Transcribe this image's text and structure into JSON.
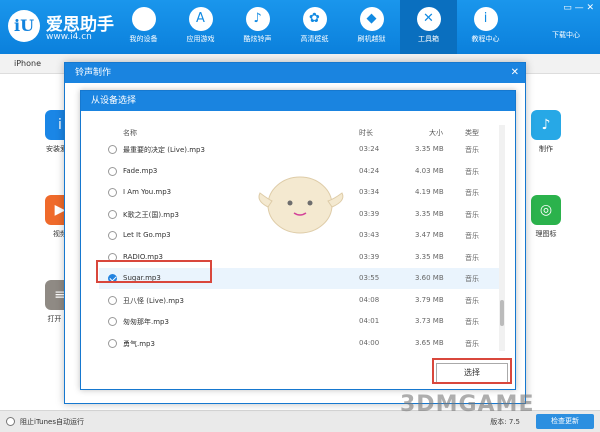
{
  "brand": {
    "name": "爱思助手",
    "url": "www.i4.cn",
    "logo": "iU"
  },
  "nav": [
    {
      "label": "我的设备",
      "icon": "apple-icon",
      "glyph": ""
    },
    {
      "label": "应用游戏",
      "icon": "appstore-icon",
      "glyph": "A"
    },
    {
      "label": "酷炫铃声",
      "icon": "bell-icon",
      "glyph": "♪"
    },
    {
      "label": "高清壁纸",
      "icon": "flower-icon",
      "glyph": "✿"
    },
    {
      "label": "刷机越狱",
      "icon": "box-icon",
      "glyph": "◆"
    },
    {
      "label": "工具箱",
      "icon": "tools-icon",
      "glyph": "✕"
    },
    {
      "label": "教程中心",
      "icon": "info-icon",
      "glyph": "i"
    }
  ],
  "window_controls": "▭  —  ✕",
  "download_label": "下载中心",
  "device_name": "iPhone",
  "bg_tools": [
    {
      "label": "安装爱思",
      "color": "#1a86e6",
      "glyph": "i"
    },
    {
      "label": "视频",
      "color": "#ef6a2b",
      "glyph": "▶"
    },
    {
      "label": "打开 SS",
      "color": "#8f8a84",
      "glyph": "≡"
    },
    {
      "label": "制作",
      "color": "#27a8e6",
      "glyph": "♪"
    },
    {
      "label": "理图标",
      "color": "#2bb24c",
      "glyph": "◎"
    }
  ],
  "bottom": {
    "left_label": "阻止iTunes自动运行",
    "right_label": "版本: 7.5",
    "feedback": "检查更新"
  },
  "outer_dialog": {
    "title": "铃声制作",
    "close": "✕"
  },
  "inner_dialog": {
    "title": "从设备选择"
  },
  "list_header": {
    "name": "名称",
    "time": "时长",
    "size": "大小",
    "type": "类型"
  },
  "files": [
    {
      "name": "最重要的决定 (Live).mp3",
      "time": "03:24",
      "size": "3.35 MB",
      "type": "音乐",
      "checked": false
    },
    {
      "name": "Fade.mp3",
      "time": "04:24",
      "size": "4.03 MB",
      "type": "音乐",
      "checked": false
    },
    {
      "name": "I Am You.mp3",
      "time": "03:34",
      "size": "4.19 MB",
      "type": "音乐",
      "checked": false
    },
    {
      "name": "K歌之王(国).mp3",
      "time": "03:39",
      "size": "3.35 MB",
      "type": "音乐",
      "checked": false
    },
    {
      "name": "Let It Go.mp3",
      "time": "03:43",
      "size": "3.47 MB",
      "type": "音乐",
      "checked": false
    },
    {
      "name": "RADIO.mp3",
      "time": "03:39",
      "size": "3.35 MB",
      "type": "音乐",
      "checked": false
    },
    {
      "name": "Sugar.mp3",
      "time": "03:55",
      "size": "3.60 MB",
      "type": "音乐",
      "checked": true
    },
    {
      "name": "丑八怪 (Live).mp3",
      "time": "04:08",
      "size": "3.79 MB",
      "type": "音乐",
      "checked": false
    },
    {
      "name": "匆匆那年.mp3",
      "time": "04:01",
      "size": "3.73 MB",
      "type": "音乐",
      "checked": false
    },
    {
      "name": "勇气.mp3",
      "time": "04:00",
      "size": "3.65 MB",
      "type": "音乐",
      "checked": false
    }
  ],
  "select_button": "选择",
  "watermark": "3DMGAME",
  "accent": "#1a84e0",
  "highlight": "#d9473c"
}
